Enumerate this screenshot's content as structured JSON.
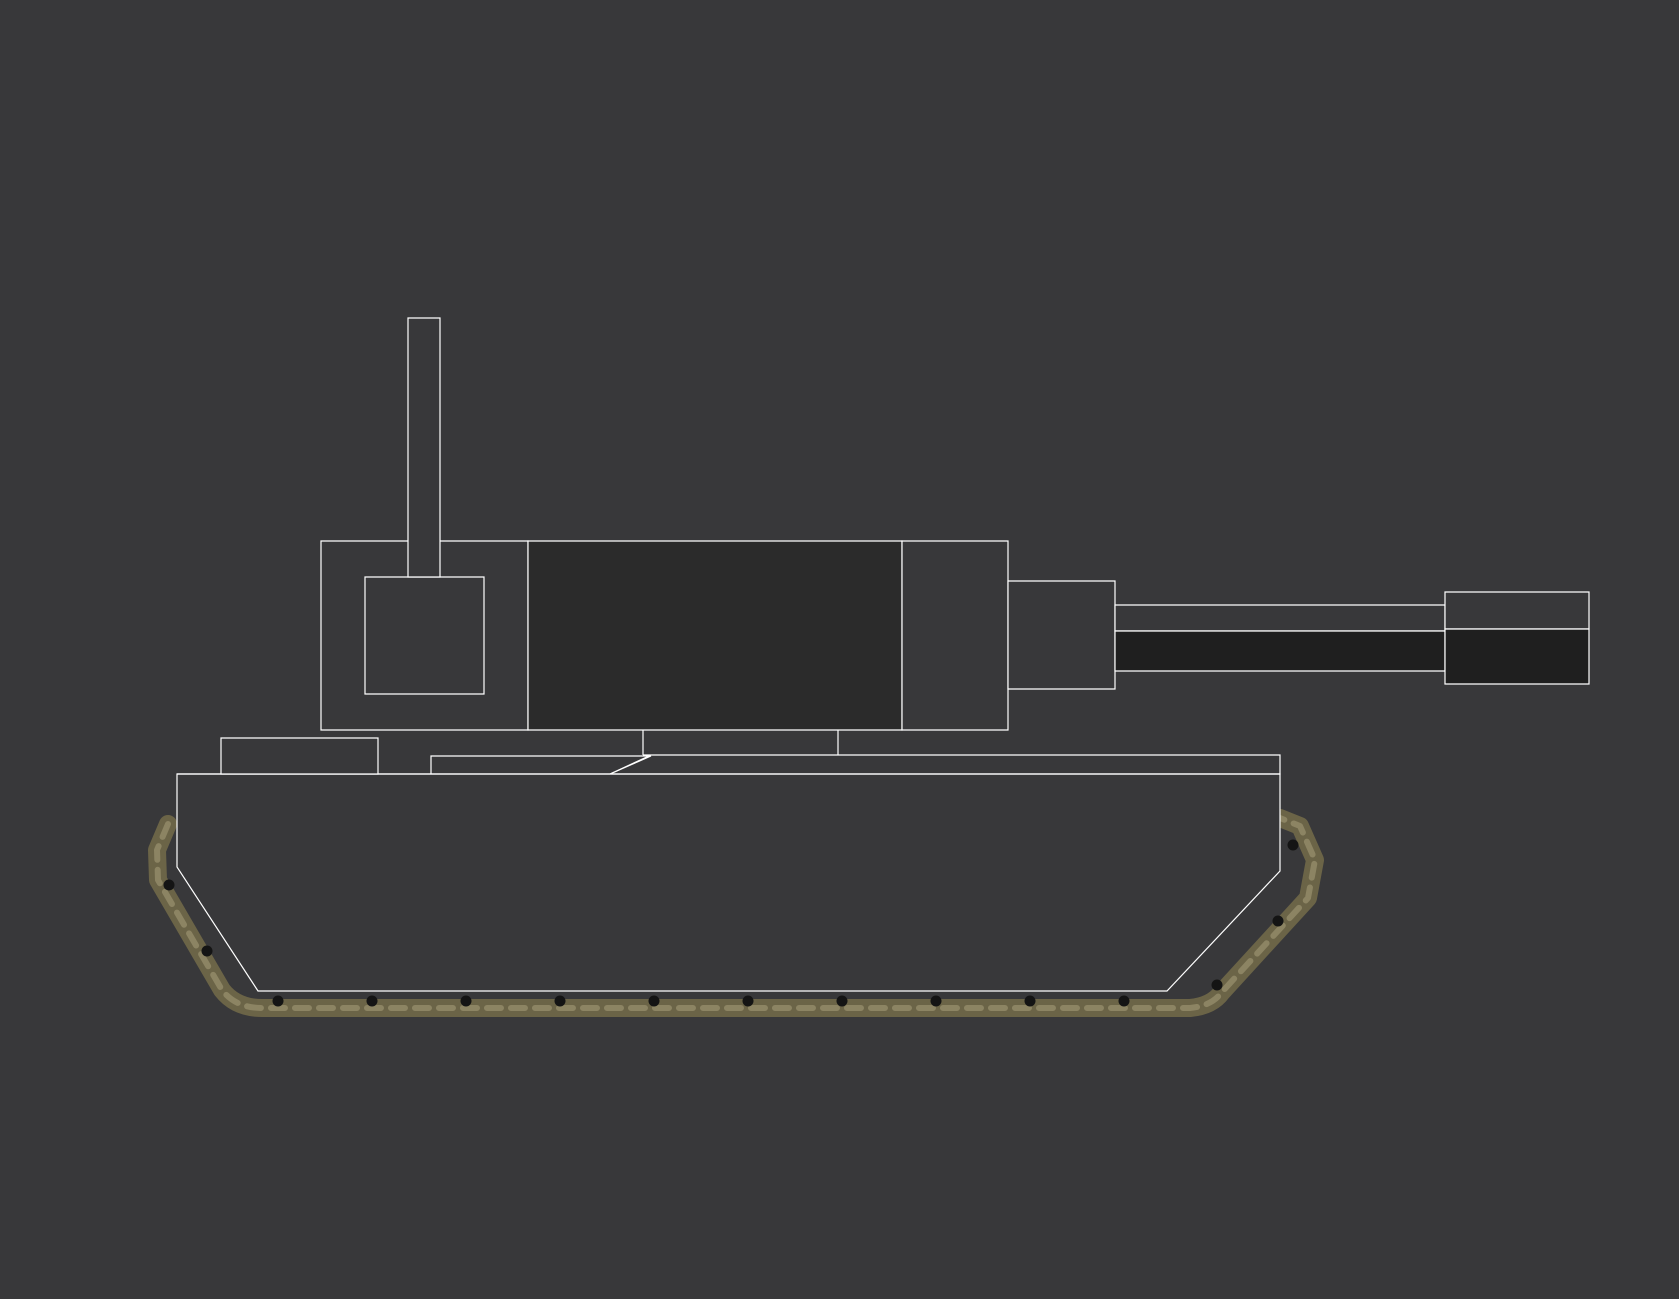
{
  "scene": {
    "background_color": "#38383a",
    "outline_color": "#ffffff",
    "part_fill": "#38383a",
    "dark_part_fill": "#2b2b2b",
    "barrel_shadow_fill": "#1f1f1f",
    "track_color": "#6b6447",
    "track_highlight": "#8c8463",
    "track_hole_color": "#141414"
  },
  "tank": {
    "parts": [
      "antenna-mast",
      "turret-rear-box",
      "turret-hatch",
      "turret-center-panel",
      "turret-front-panel",
      "gun-mantlet",
      "gun-barrel",
      "muzzle-brake",
      "hull-upper-deck",
      "hull-body",
      "hull-rear-box",
      "track-band"
    ],
    "icons": [
      "tank-icon"
    ]
  }
}
